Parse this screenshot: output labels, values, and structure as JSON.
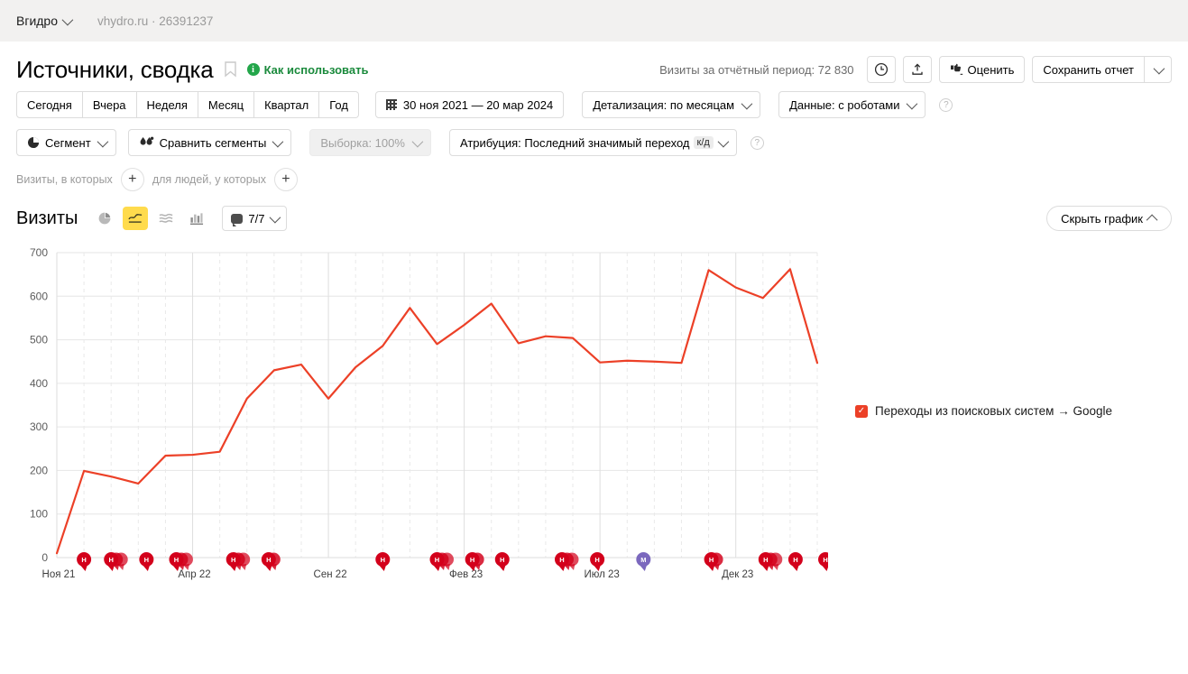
{
  "topbar": {
    "account": "Вгидро",
    "site": "vhydro.ru · 26391237"
  },
  "header": {
    "title": "Источники, сводка",
    "howto": "Как использовать",
    "info_glyph": "i",
    "visits_summary": "Визиты за отчётный период: 72 830",
    "rate_button": "Оценить",
    "save_report": "Сохранить отчет"
  },
  "period_tabs": [
    {
      "label": "Сегодня"
    },
    {
      "label": "Вчера"
    },
    {
      "label": "Неделя"
    },
    {
      "label": "Месяц"
    },
    {
      "label": "Квартал"
    },
    {
      "label": "Год"
    }
  ],
  "date_range": "30 ноя 2021 — 20 мар 2024",
  "detail_select": "Детализация: по месяцам",
  "data_select": "Данные: с роботами",
  "filters": {
    "segment": "Сегмент",
    "compare_segments": "Сравнить сегменты",
    "sample": "Выборка: 100%",
    "attribution": "Атрибуция: Последний значимый переход",
    "attribution_tag": "к/д"
  },
  "segment_builder": {
    "visits_label": "Визиты, в которых",
    "people_label": "для людей, у которых",
    "plus": "+"
  },
  "chart_panel": {
    "title": "Визиты",
    "metrics_pill": "7/7",
    "hide_chart": "Скрыть график",
    "viz_buttons": [
      {
        "name": "pie-chart-icon",
        "active": false
      },
      {
        "name": "line-chart-icon",
        "active": true
      },
      {
        "name": "area-chart-icon",
        "active": false
      },
      {
        "name": "bar-chart-icon",
        "active": false
      }
    ]
  },
  "colors": {
    "series_red": "#ec4027",
    "accent_yellow": "#ffdb4d",
    "green": "#23a64a",
    "marker_red": "#d3001b",
    "marker_purple": "#7b68be",
    "grid": "#e6e6e6",
    "topbar_bg": "#f2f1f0"
  },
  "chart_data": {
    "type": "line",
    "title": "Визиты",
    "xlabel": "",
    "ylabel": "",
    "ylim": [
      0,
      700
    ],
    "yticks": [
      0,
      100,
      200,
      300,
      400,
      500,
      600,
      700
    ],
    "grid": true,
    "legend_position": "right",
    "xticks": [
      "Ноя 21",
      "Апр 22",
      "Сен 22",
      "Фев 23",
      "Июл 23",
      "Дек 23"
    ],
    "xtick_indices": [
      0,
      5,
      10,
      15,
      20,
      25
    ],
    "x": [
      "Ноя 21",
      "Дек 21",
      "Янв 22",
      "Фев 22",
      "Мар 22",
      "Апр 22",
      "Май 22",
      "Июн 22",
      "Июл 22",
      "Авг 22",
      "Сен 22",
      "Окт 22",
      "Ноя 22",
      "Дек 22",
      "Янв 23",
      "Фев 23",
      "Мар 23",
      "Апр 23",
      "Май 23",
      "Июн 23",
      "Июл 23",
      "Авг 23",
      "Сен 23",
      "Окт 23",
      "Ноя 23",
      "Дек 23",
      "Янв 24",
      "Фев 24",
      "Мар 24"
    ],
    "series": [
      {
        "name": "Переходы из поисковых систем → Google",
        "color": "#ec4027",
        "checked": true,
        "values": [
          10,
          199,
          186,
          170,
          234,
          236,
          243,
          365,
          430,
          443,
          365,
          437,
          486,
          573,
          490,
          534,
          583,
          492,
          508,
          504,
          448,
          452,
          450,
          447,
          660,
          620,
          596,
          662,
          447
        ]
      }
    ],
    "annotations": [
      {
        "x_index": 1,
        "label": "Н",
        "color": "#d3001b",
        "stack": 1
      },
      {
        "x_index": 2,
        "label": "Н",
        "color": "#d3001b",
        "stack": 3
      },
      {
        "x_index": 3.3,
        "label": "Н",
        "color": "#d3001b",
        "stack": 1
      },
      {
        "x_index": 4.4,
        "label": "Н",
        "color": "#d3001b",
        "stack": 3
      },
      {
        "x_index": 6.5,
        "label": "Н",
        "color": "#d3001b",
        "stack": 3
      },
      {
        "x_index": 7.8,
        "label": "Н",
        "color": "#d3001b",
        "stack": 2
      },
      {
        "x_index": 12.0,
        "label": "Н",
        "color": "#d3001b",
        "stack": 1
      },
      {
        "x_index": 14.0,
        "label": "Н",
        "color": "#d3001b",
        "stack": 3
      },
      {
        "x_index": 15.3,
        "label": "Н",
        "color": "#d3001b",
        "stack": 2
      },
      {
        "x_index": 16.4,
        "label": "Н",
        "color": "#d3001b",
        "stack": 1
      },
      {
        "x_index": 18.6,
        "label": "Н",
        "color": "#d3001b",
        "stack": 3
      },
      {
        "x_index": 19.9,
        "label": "Н",
        "color": "#d3001b",
        "stack": 1
      },
      {
        "x_index": 21.6,
        "label": "М",
        "color": "#7b68be",
        "stack": 1
      },
      {
        "x_index": 24.1,
        "label": "Н",
        "color": "#d3001b",
        "stack": 2
      },
      {
        "x_index": 26.1,
        "label": "Н",
        "color": "#d3001b",
        "stack": 3
      },
      {
        "x_index": 27.2,
        "label": "Н",
        "color": "#d3001b",
        "stack": 1
      },
      {
        "x_index": 28.3,
        "label": "Н",
        "color": "#d3001b",
        "stack": 1
      }
    ]
  }
}
